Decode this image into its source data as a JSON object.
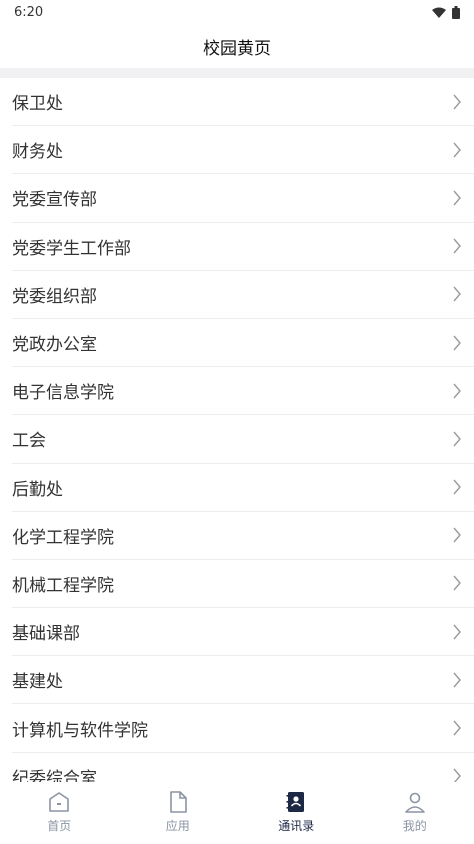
{
  "status": {
    "time": "6:20"
  },
  "header": {
    "title": "校园黄页"
  },
  "list": [
    "保卫处",
    "财务处",
    "党委宣传部",
    "党委学生工作部",
    "党委组织部",
    "党政办公室",
    "电子信息学院",
    "工会",
    "后勤处",
    "化学工程学院",
    "机械工程学院",
    "基础课部",
    "基建处",
    "计算机与软件学院",
    "纪委综合室"
  ],
  "tabs": {
    "home": "首页",
    "apps": "应用",
    "contacts": "通讯录",
    "me": "我的"
  },
  "colors": {
    "active_tab": "#1d2845",
    "inactive_tab": "#8b94a3",
    "band": "#f1f1f3"
  }
}
